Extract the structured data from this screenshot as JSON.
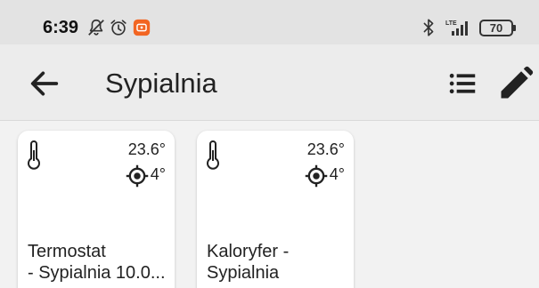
{
  "status_bar": {
    "time": "6:39",
    "battery": "70",
    "network": "LTE",
    "icons": [
      "notifications-off-icon",
      "alarm-icon",
      "app-notification-icon",
      "bluetooth-icon",
      "signal-icon",
      "battery-icon"
    ]
  },
  "toolbar": {
    "title": "Sypialnia",
    "back_icon": "arrow-back-icon",
    "list_icon": "list-icon",
    "edit_icon": "pencil-icon"
  },
  "devices": [
    {
      "name_line1": "Termostat",
      "name_line2": "- Sypialnia 10.0...",
      "temperature": "23.6°",
      "setpoint": "4°",
      "icon": "thermometer-icon"
    },
    {
      "name_line1": "Kaloryfer -",
      "name_line2": "Sypialnia",
      "temperature": "23.6°",
      "setpoint": "4°",
      "icon": "thermometer-icon"
    }
  ],
  "colors": {
    "status_bar_bg": "#e3e3e3",
    "toolbar_bg": "#ececec",
    "content_bg": "#f2f2f2",
    "card_bg": "#ffffff",
    "app_icon": "#f26522",
    "text": "#222222"
  }
}
